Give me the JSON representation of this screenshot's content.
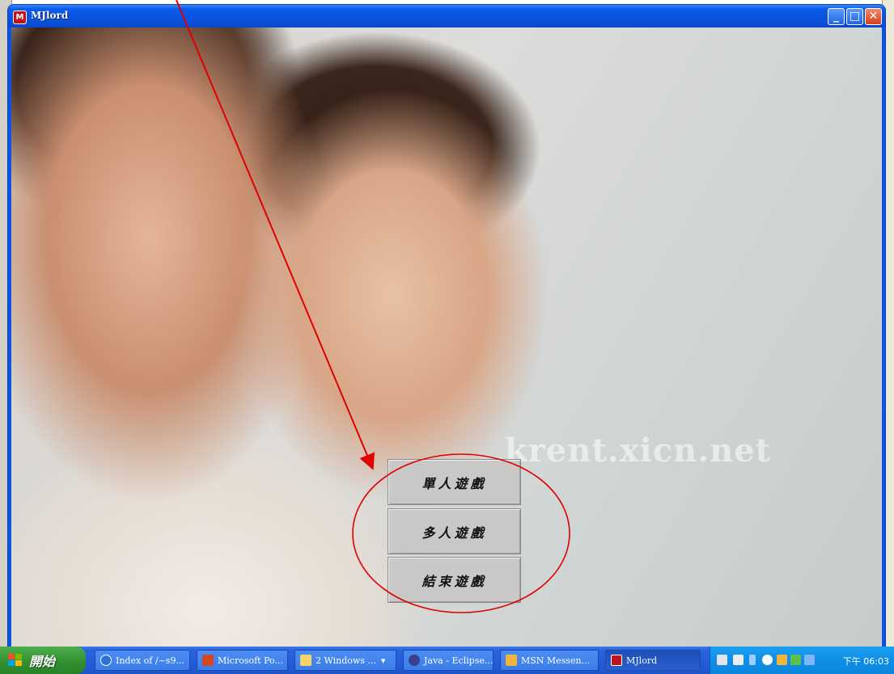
{
  "window": {
    "title": "MJlord",
    "app_icon_glyph": "M"
  },
  "watermark": "krent.xicn.net",
  "menu": {
    "single_player": "單人遊戲",
    "multi_player": "多人遊戲",
    "exit_game": "結束遊戲"
  },
  "annotation": {
    "color": "#e00000"
  },
  "taskbar": {
    "start_label": "開始",
    "tasks": [
      {
        "label": "Index of /~s9...",
        "icon": "browser-icon"
      },
      {
        "label": "Microsoft Po...",
        "icon": "powerpoint-icon"
      },
      {
        "label": "2 Windows ...",
        "icon": "folder-icon"
      },
      {
        "label": "Java - Eclipse...",
        "icon": "eclipse-icon"
      },
      {
        "label": "MSN Messen...",
        "icon": "msn-icon"
      },
      {
        "label": "MJlord",
        "icon": "mjlord-icon"
      }
    ],
    "clock": "下午 06:03"
  }
}
